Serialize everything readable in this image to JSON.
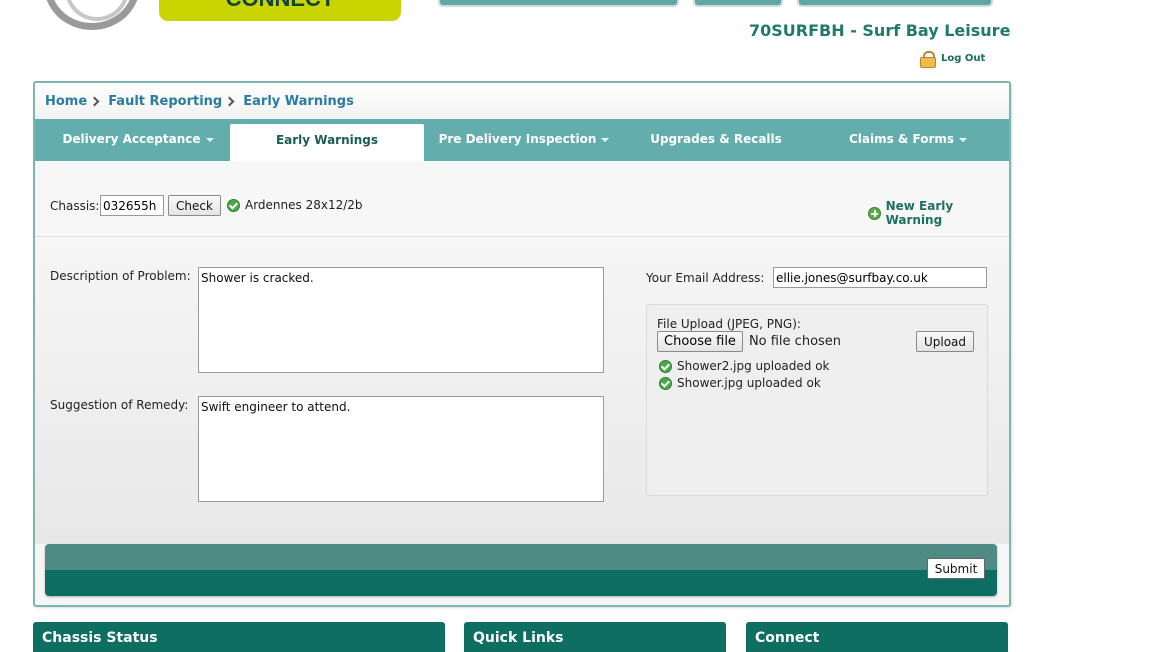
{
  "header": {
    "brand_badge": "CONNECT",
    "dealer_title": "70SURFBH - Surf Bay Leisure",
    "logout_label": "Log Out"
  },
  "breadcrumb": [
    "Home",
    "Fault Reporting",
    "Early Warnings"
  ],
  "nav": {
    "tabs": [
      {
        "label": "Delivery Acceptance",
        "dropdown": true,
        "active": false
      },
      {
        "label": "Early Warnings",
        "dropdown": false,
        "active": true
      },
      {
        "label": "Pre Delivery Inspection",
        "dropdown": true,
        "active": false
      },
      {
        "label": "Upgrades & Recalls",
        "dropdown": false,
        "active": false
      },
      {
        "label": "Claims & Forms",
        "dropdown": true,
        "active": false
      }
    ]
  },
  "chassis": {
    "label": "Chassis:",
    "value": "032655h",
    "check_label": "Check",
    "model_text": "Ardennes 28x12/2b"
  },
  "new_early_warning_label": "New Early Warning",
  "form": {
    "description_label": "Description of Problem:",
    "description_value": "Shower is cracked.",
    "remedy_label": "Suggestion of Remedy:",
    "remedy_value": "Swift engineer to attend.",
    "email_label": "Your Email Address:",
    "email_value": "ellie.jones@surfbay.co.uk",
    "upload_label": "File Upload (JPEG, PNG):",
    "choose_file_label": "Choose file",
    "no_file_text": "No file chosen",
    "upload_button_label": "Upload",
    "uploaded_files": [
      "Shower2.jpg uploaded ok",
      "Shower.jpg uploaded ok"
    ],
    "submit_label": "Submit"
  },
  "bottom_panels": [
    "Chassis Status",
    "Quick Links",
    "Connect"
  ],
  "colors": {
    "teal_nav": "#63aead",
    "dark_teal": "#0f6e62",
    "link_blue": "#2a7c9f",
    "brand_yellow": "#cad400"
  }
}
